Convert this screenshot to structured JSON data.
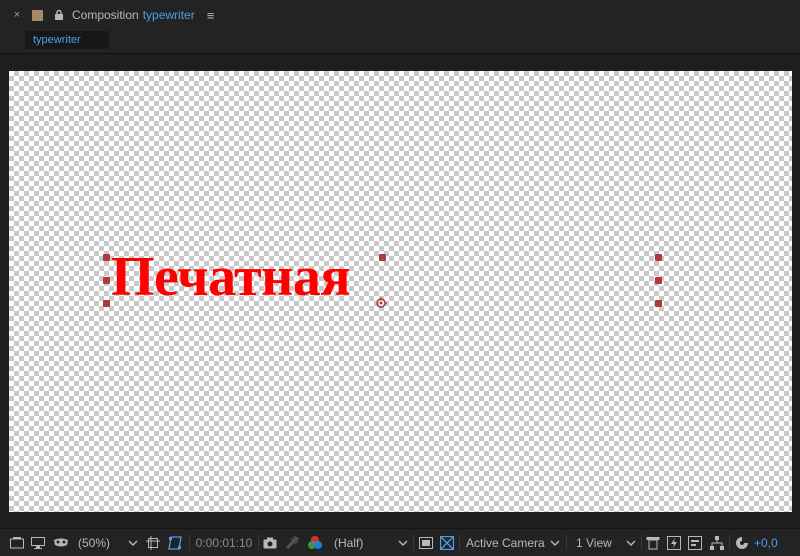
{
  "panel": {
    "close_glyph": "×",
    "title_prefix": "Composition",
    "composition_name": "typewriter",
    "menu_glyph": "≡",
    "swatch_color": "#a58a6a",
    "accent_color": "#4d9ee8"
  },
  "tabs": [
    {
      "label": "typewriter",
      "active": true
    }
  ],
  "canvas": {
    "text_layer": "Печатная",
    "text_color": "#ff0000"
  },
  "toolbar": {
    "magnification": "(50%)",
    "timecode": "0:00:01:10",
    "resolution": "(Half)",
    "camera": "Active Camera",
    "views": "1 View",
    "exposure": "+0,0",
    "icons": [
      "always-preview-icon",
      "monitor-icon",
      "mask-visibility-icon",
      "grid-guides-icon",
      "region-of-interest-icon",
      "snapshot-icon",
      "show-snapshot-icon",
      "color-channels-icon",
      "fast-previews-icon",
      "transparency-grid-icon",
      "3d-draft-icon",
      "timeline-icon",
      "flowchart-icon",
      "reset-exposure-icon"
    ]
  }
}
